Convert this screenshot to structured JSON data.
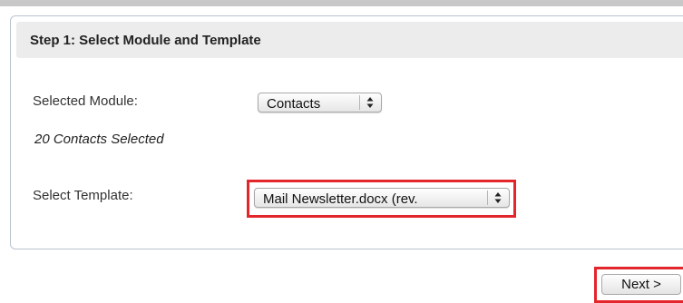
{
  "step": {
    "title": "Step 1: Select Module and Template"
  },
  "module": {
    "label": "Selected Module:",
    "value": "Contacts",
    "selection_count": "20 Contacts Selected"
  },
  "template": {
    "label": "Select Template:",
    "value": "Mail Newsletter.docx (rev."
  },
  "actions": {
    "next_label": "Next >"
  },
  "colors": {
    "highlight": "#e3262b",
    "header_bg": "#ececec",
    "panel_border": "#b9c4cf"
  },
  "icons": {
    "select_arrow": "up-down-arrows-icon"
  }
}
